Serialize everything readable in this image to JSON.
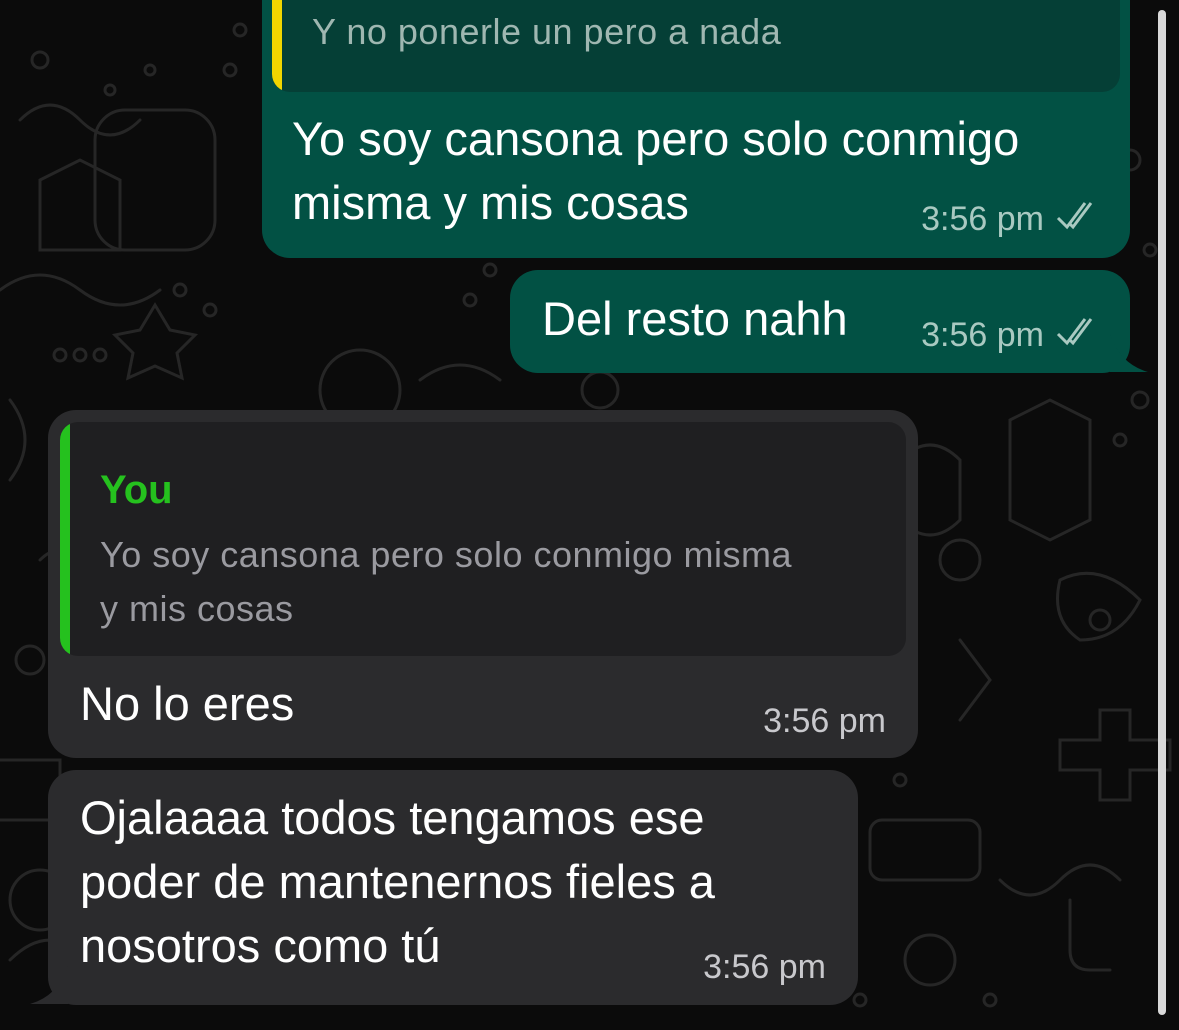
{
  "colors": {
    "outgoing_bubble": "#025144",
    "incoming_bubble": "#2b2b2d",
    "quote_yellow": "#f2d600",
    "quote_green": "#25c11e",
    "sender_name_green": "#25c11e"
  },
  "messages": [
    {
      "direction": "outgoing",
      "quote_text": "Y no ponerle un pero a nada",
      "text_lines": [
        "Yo soy cansona pero solo conmigo",
        "misma y mis cosas"
      ],
      "time": "3:56 pm",
      "status_icon": "double-check-icon"
    },
    {
      "direction": "outgoing",
      "text_lines": [
        "Del resto nahh"
      ],
      "time": "3:56 pm",
      "status_icon": "double-check-icon"
    },
    {
      "direction": "incoming",
      "quote_sender": "You",
      "quote_text_lines": [
        "Yo soy cansona pero solo conmigo misma",
        "y mis cosas"
      ],
      "text_lines": [
        "No lo eres"
      ],
      "time": "3:56 pm"
    },
    {
      "direction": "incoming",
      "text_lines": [
        "Ojalaaaa todos tengamos ese",
        "poder de mantenernos fieles a",
        "nosotros como tú"
      ],
      "time": "3:56 pm"
    }
  ]
}
